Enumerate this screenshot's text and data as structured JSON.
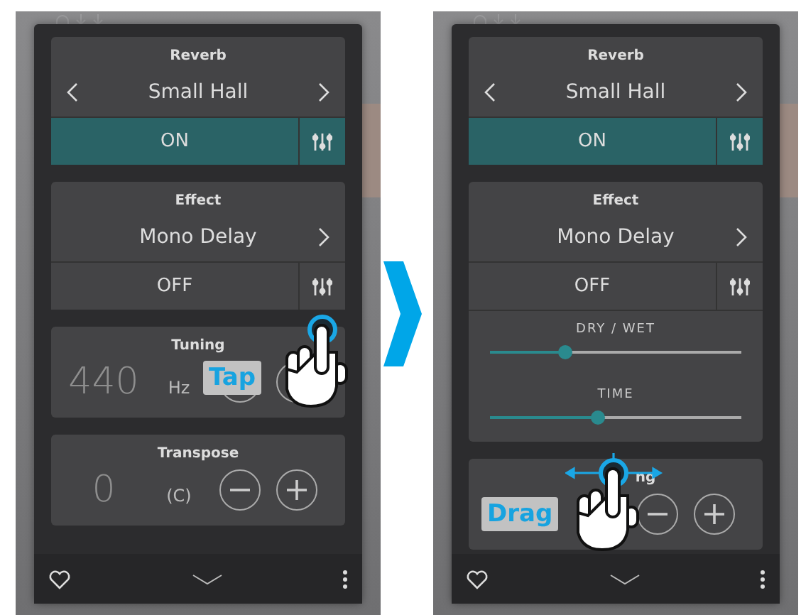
{
  "screens": [
    {
      "cards": [
        {
          "kind": "selector",
          "title": "Reverb",
          "value": "Small Hall",
          "has_prev": true,
          "toggle": "ON",
          "on": true
        },
        {
          "kind": "selector",
          "title": "Effect",
          "value": "Mono Delay",
          "has_prev": false,
          "toggle": "OFF",
          "on": false
        },
        {
          "kind": "stepper",
          "title": "Tuning",
          "value": "440",
          "unit": "Hz"
        },
        {
          "kind": "stepper",
          "title": "Transpose",
          "value": "0",
          "unit": "(C)"
        }
      ],
      "gesture": {
        "kind": "tap",
        "label": "Tap"
      }
    },
    {
      "cards": [
        {
          "kind": "selector",
          "title": "Reverb",
          "value": "Small Hall",
          "has_prev": true,
          "toggle": "ON",
          "on": true
        },
        {
          "kind": "selector",
          "title": "Effect",
          "value": "Mono Delay",
          "has_prev": false,
          "toggle": "OFF",
          "on": false,
          "sliders": [
            {
              "label": "DRY / WET",
              "level": 0.3
            },
            {
              "label": "TIME",
              "level": 0.43
            }
          ]
        },
        {
          "kind": "stepper",
          "title": "ng"
        }
      ],
      "gesture": {
        "kind": "drag",
        "label": "Drag"
      }
    }
  ]
}
